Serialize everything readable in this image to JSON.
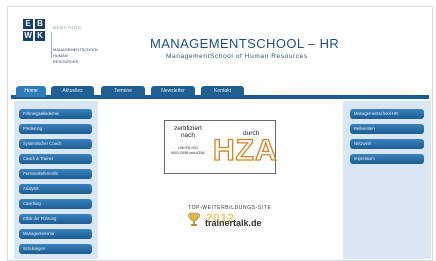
{
  "logo": {
    "letters": [
      "E",
      "B",
      "W",
      "K"
    ],
    "tagline": "BERATUNG",
    "lines": [
      "MANAGEMENTSCHOOL",
      "HUMAN",
      "RESOURCES"
    ]
  },
  "header": {
    "title": "MANAGEMENTSCHOOL – HR",
    "subtitle": "ManagementSchool of Human Resources"
  },
  "nav": {
    "tabs": [
      {
        "label": "Home",
        "active": true
      },
      {
        "label": "Aktuelles",
        "active": false
      },
      {
        "label": "Termine",
        "active": false
      },
      {
        "label": "Newsletter",
        "active": false
      },
      {
        "label": "Kontakt",
        "active": false
      }
    ]
  },
  "left_menu": [
    "Führungsakademie",
    "Förderung",
    "Systemischer Coach",
    "Coach & Trainer",
    "Personalreferent/in",
    "Analysis",
    "Coaching",
    "Ethik der Führung",
    "Managerseminar",
    "Schulungen"
  ],
  "right_menu": [
    "Managementschool-HR",
    "Referenten",
    "Netzwerk",
    "Impressum"
  ],
  "badge": {
    "line1": "zertifiziert",
    "line2": "nach",
    "line3": "DIN EN ISO 9001:2008 und AZAV",
    "durch": "durch",
    "logo_text": "HZA"
  },
  "award": {
    "label": "TOP-WEITERBILDUNGS-SITE",
    "year": "2012",
    "site": "trainertalk.de"
  },
  "colors": {
    "primary": "#1e5b8c",
    "sidebar_bg": "#d9e6f4",
    "title": "#1b4f86",
    "accent": "#d9821e"
  }
}
